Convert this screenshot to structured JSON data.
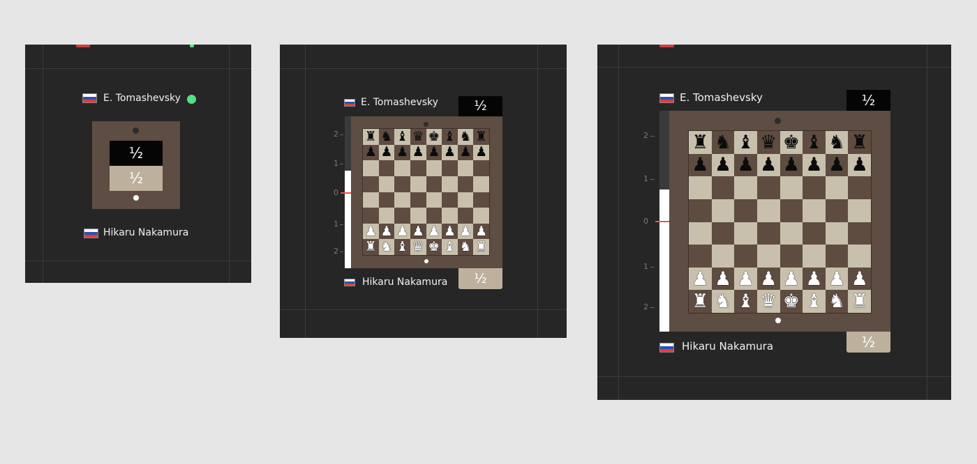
{
  "players": {
    "top": {
      "name": "E. Tomashevsky",
      "flag": "russia-flag-icon"
    },
    "bottom": {
      "name": "Hikaru Nakamura",
      "flag": "russia-flag-icon"
    }
  },
  "result": {
    "top_score": "½",
    "bottom_score": "½"
  },
  "eval_axis_labels": [
    "2",
    "1",
    "0",
    "1",
    "2"
  ],
  "board_position": [
    [
      "r",
      "n",
      "b",
      "q",
      "k",
      "b",
      "n",
      "r"
    ],
    [
      "p",
      "p",
      "p",
      "p",
      "p",
      "p",
      "p",
      "p"
    ],
    [
      "",
      "",
      "",
      "",
      "",
      "",
      "",
      ""
    ],
    [
      "",
      "",
      "",
      "",
      "",
      "",
      "",
      ""
    ],
    [
      "",
      "",
      "",
      "",
      "",
      "",
      "",
      ""
    ],
    [
      "",
      "",
      "",
      "",
      "",
      "",
      "",
      ""
    ],
    [
      "P",
      "P",
      "P",
      "P",
      "P",
      "P",
      "P",
      "P"
    ],
    [
      "R",
      "N",
      "B",
      "Q",
      "K",
      "B",
      "N",
      "R"
    ]
  ],
  "colors": {
    "background": "#e6e6e6",
    "panel": "#262626",
    "board_light": "#c8c0ac",
    "board_dark": "#5e4c41",
    "frame": "#5d4d42",
    "online_status": "#4ee57f",
    "eval_marker": "#e8544a"
  }
}
